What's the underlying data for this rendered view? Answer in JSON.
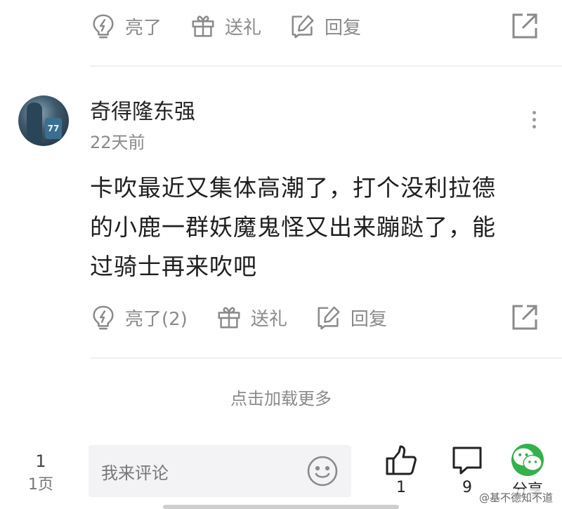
{
  "top_actions": {
    "like_label": "亮了",
    "gift_label": "送礼",
    "reply_label": "回复"
  },
  "comment": {
    "username": "奇得隆东强",
    "avatar_jersey": "77",
    "time": "22天前",
    "lines": [
      "卡吹最近又集体高潮了，打个没利拉德",
      "的小鹿一群妖魔鬼怪又出来蹦跶了，能",
      "过骑士再来吹吧"
    ],
    "like_label": "亮了(2)",
    "gift_label": "送礼",
    "reply_label": "回复"
  },
  "load_more": "点击加载更多",
  "bottom_bar": {
    "page_current": "1",
    "page_label": "1页",
    "input_placeholder": "我来评论",
    "like_count": "1",
    "comment_count": "9",
    "share_label": "分享"
  },
  "watermark": "@基不德知不道",
  "colors": {
    "icon_gray": "#8a8a8a",
    "wechat_green": "#34b04c",
    "input_bg": "#f3f3f6"
  }
}
